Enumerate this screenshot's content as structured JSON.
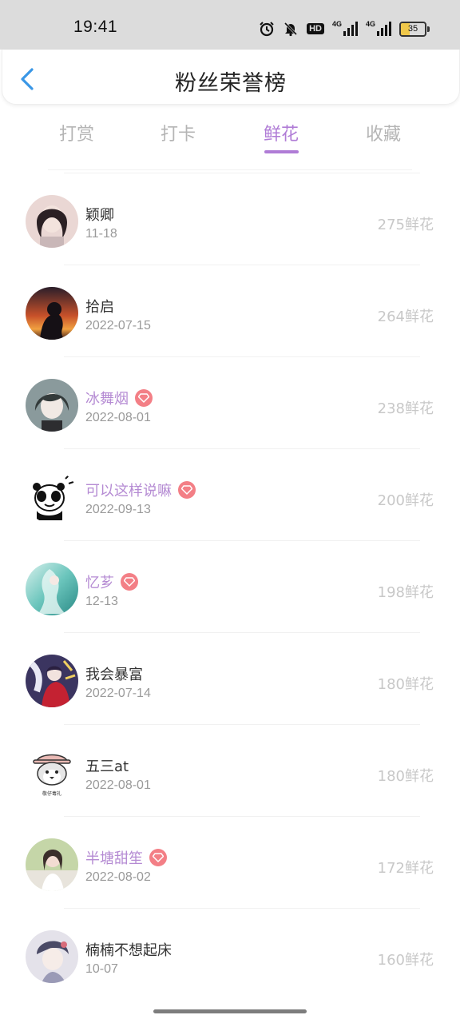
{
  "status_bar": {
    "time": "19:41",
    "hd_label": "HD",
    "signal_label_1": "4G",
    "signal_label_2": "4G",
    "battery_percent": "35",
    "battery_level": 0.35,
    "icons": [
      "alarm-icon",
      "bell-muted-icon",
      "hd-icon",
      "signal-icon",
      "signal-icon",
      "battery-icon"
    ]
  },
  "header": {
    "title": "粉丝荣誉榜",
    "back_icon": "chevron-left-icon",
    "accent_color": "#3a97e6"
  },
  "tabs": [
    {
      "label": "打赏",
      "active": false
    },
    {
      "label": "打卡",
      "active": false
    },
    {
      "label": "鲜花",
      "active": true
    },
    {
      "label": "收藏",
      "active": false
    }
  ],
  "theme": {
    "active_tab_color": "#b07cd6",
    "vip_name_color": "#b58bd3",
    "vip_badge_color": "#f37f86"
  },
  "fans": [
    {
      "name": "颖卿",
      "date": "11-18",
      "count": "275鲜花",
      "vip": false,
      "avatar": "avatar-girl-portrait"
    },
    {
      "name": "拾启",
      "date": "2022-07-15",
      "count": "264鲜花",
      "vip": false,
      "avatar": "avatar-sunset-silhouette"
    },
    {
      "name": "冰舞烟",
      "date": "2022-08-01",
      "count": "238鲜花",
      "vip": true,
      "avatar": "avatar-anime-girl"
    },
    {
      "name": "可以这样说嘛",
      "date": "2022-09-13",
      "count": "200鲜花",
      "vip": true,
      "avatar": "avatar-panda-meme"
    },
    {
      "name": "忆芗",
      "date": "12-13",
      "count": "198鲜花",
      "vip": true,
      "avatar": "avatar-teal-illustration"
    },
    {
      "name": "我会暴富",
      "date": "2022-07-14",
      "count": "180鲜花",
      "vip": false,
      "avatar": "avatar-colorful-anime"
    },
    {
      "name": "五三at",
      "date": "2022-08-01",
      "count": "180鲜花",
      "vip": false,
      "avatar": "avatar-penguin-cartoon"
    },
    {
      "name": "半塘甜笙",
      "date": "2022-08-02",
      "count": "172鲜花",
      "vip": true,
      "avatar": "avatar-girl-photo"
    },
    {
      "name": "楠楠不想起床",
      "date": "10-07",
      "count": "160鲜花",
      "vip": false,
      "avatar": "avatar-sketch-girl"
    }
  ]
}
